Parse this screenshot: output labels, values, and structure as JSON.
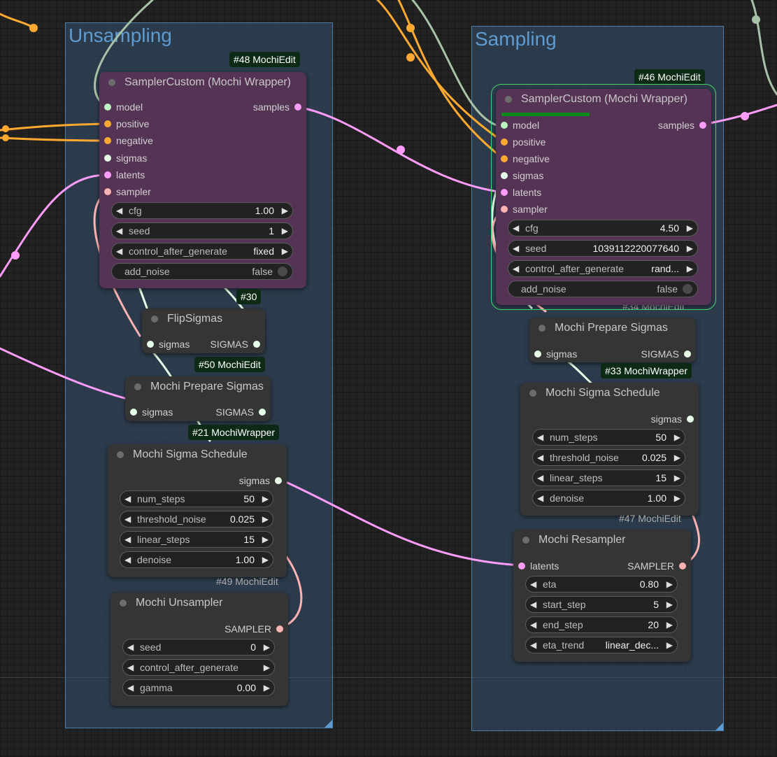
{
  "colors": {
    "canvas": "#222222",
    "group_fill": "#3a5e80",
    "group_title": "#5e9bd0",
    "node_body": "#353535",
    "node_purple": "#553355",
    "wire_model": "#a8c2a8",
    "wire_conditioning": "#ffa931",
    "wire_latent": "#ff9cf9",
    "wire_sigmas": "#e6ffe6",
    "wire_sampler": "#ffb3b3",
    "badge_bg": "#0d2a16",
    "progress": "#0b8a14"
  },
  "groups": {
    "unsampling": {
      "title": "Unsampling"
    },
    "sampling": {
      "title": "Sampling"
    }
  },
  "badges": {
    "u_sampler": "#48 MochiEdit",
    "s_sampler": "#46 MochiEdit",
    "u_flip": "#30",
    "u_prepare": "#50 MochiEdit",
    "u_schedule": "#21 MochiWrapper",
    "u_unsampler": "#49 MochiEdit",
    "s_schedule": "#33 MochiWrapper",
    "s_resampler": "#47 MochiEdit",
    "s_prepare": "#34 MochiEdit"
  },
  "nodes": {
    "u_sampler": {
      "title": "SamplerCustom (Mochi Wrapper)",
      "inputs": [
        "model",
        "positive",
        "negative",
        "sigmas",
        "latents",
        "sampler"
      ],
      "output": "samples",
      "widgets": {
        "cfg": {
          "label": "cfg",
          "value": "1.00"
        },
        "seed": {
          "label": "seed",
          "value": "1"
        },
        "cag": {
          "label": "control_after_generate",
          "value": "fixed"
        },
        "add_noise": {
          "label": "add_noise",
          "value": "false"
        }
      }
    },
    "s_sampler": {
      "title": "SamplerCustom (Mochi Wrapper)",
      "progress": 0.43,
      "inputs": [
        "model",
        "positive",
        "negative",
        "sigmas",
        "latents",
        "sampler"
      ],
      "output": "samples",
      "widgets": {
        "cfg": {
          "label": "cfg",
          "value": "4.50"
        },
        "seed": {
          "label": "seed",
          "value": "1039112220077640"
        },
        "cag": {
          "label": "control_after_generate",
          "value": "rand..."
        },
        "add_noise": {
          "label": "add_noise",
          "value": "false"
        }
      }
    },
    "u_flip": {
      "title": "FlipSigmas",
      "input": "sigmas",
      "output": "SIGMAS"
    },
    "u_prepare": {
      "title": "Mochi Prepare Sigmas",
      "input": "sigmas",
      "output": "SIGMAS"
    },
    "s_prepare": {
      "title": "Mochi Prepare Sigmas",
      "input": "sigmas",
      "output": "SIGMAS"
    },
    "u_schedule": {
      "title": "Mochi Sigma Schedule",
      "output": "sigmas",
      "widgets": {
        "num_steps": {
          "label": "num_steps",
          "value": "50"
        },
        "threshold_noise": {
          "label": "threshold_noise",
          "value": "0.025"
        },
        "linear_steps": {
          "label": "linear_steps",
          "value": "15"
        },
        "denoise": {
          "label": "denoise",
          "value": "1.00"
        }
      }
    },
    "s_schedule": {
      "title": "Mochi Sigma Schedule",
      "output": "sigmas",
      "widgets": {
        "num_steps": {
          "label": "num_steps",
          "value": "50"
        },
        "threshold_noise": {
          "label": "threshold_noise",
          "value": "0.025"
        },
        "linear_steps": {
          "label": "linear_steps",
          "value": "15"
        },
        "denoise": {
          "label": "denoise",
          "value": "1.00"
        }
      }
    },
    "u_unsampler": {
      "title": "Mochi Unsampler",
      "output": "SAMPLER",
      "widgets": {
        "seed": {
          "label": "seed",
          "value": "0"
        },
        "cag": {
          "label": "control_after_generate",
          "value": ""
        },
        "gamma": {
          "label": "gamma",
          "value": "0.00"
        }
      }
    },
    "s_resampler": {
      "title": "Mochi Resampler",
      "input": "latents",
      "output": "SAMPLER",
      "widgets": {
        "eta": {
          "label": "eta",
          "value": "0.80"
        },
        "start_step": {
          "label": "start_step",
          "value": "5"
        },
        "end_step": {
          "label": "end_step",
          "value": "20"
        },
        "eta_trend": {
          "label": "eta_trend",
          "value": "linear_dec..."
        }
      }
    }
  },
  "icons": {
    "decrement": "◀",
    "increment": "▶"
  }
}
